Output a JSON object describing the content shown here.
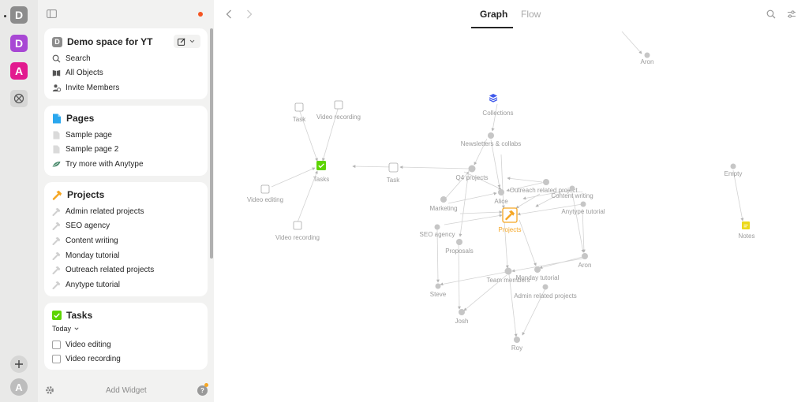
{
  "spaces": [
    {
      "letter": "D",
      "color": "#8c8c8c"
    },
    {
      "letter": "D",
      "color": "#a848d4"
    },
    {
      "letter": "A",
      "color": "#e21a8f"
    }
  ],
  "profile_letter": "A",
  "space": {
    "icon_letter": "D",
    "name": "Demo space for YT"
  },
  "nav": {
    "search": "Search",
    "all_objects": "All Objects",
    "invite": "Invite Members"
  },
  "pages": {
    "title": "Pages",
    "items": [
      "Sample page",
      "Sample page 2",
      "Try more with Anytype"
    ]
  },
  "projects": {
    "title": "Projects",
    "items": [
      "Admin related projects",
      "SEO agency",
      "Content writing",
      "Monday tutorial",
      "Outreach related projects",
      "Anytype tutorial"
    ]
  },
  "tasks": {
    "title": "Tasks",
    "filter": "Today",
    "items": [
      "Video editing",
      "Video recording"
    ]
  },
  "bottom": {
    "add_widget": "Add Widget",
    "help": "?"
  },
  "tabs": {
    "graph": "Graph",
    "flow": "Flow"
  },
  "colors": {
    "accent_orange": "#f5a623",
    "task_green": "#5dd400",
    "collections_blue": "#3e58eb",
    "notes_yellow": "#ecd91b",
    "notification": "#f55522"
  },
  "graph": {
    "nodes": {
      "aron_top": "Aron",
      "task1": "Task",
      "video_recording1": "Video recording",
      "collections": "Collections",
      "newsletters": "Newsletters & collabs",
      "tasks": "Tasks",
      "task2": "Task",
      "q4": "Q4 projects",
      "outreach": "Outreach related project...",
      "content": "Content writing",
      "empty": "Empty",
      "video_editing": "Video editing",
      "marketing": "Marketing",
      "alice": "Alice",
      "anytype_tutorial": "Anytype tutorial",
      "projects": "Projects",
      "notes": "Notes",
      "seo": "SEO agency",
      "video_recording2": "Video recording",
      "proposals": "Proposals",
      "aron": "Aron",
      "team": "Team members",
      "monday": "Monday tutorial",
      "steve": "Steve",
      "admin": "Admin related projects",
      "josh": "Josh",
      "roy": "Roy"
    }
  }
}
